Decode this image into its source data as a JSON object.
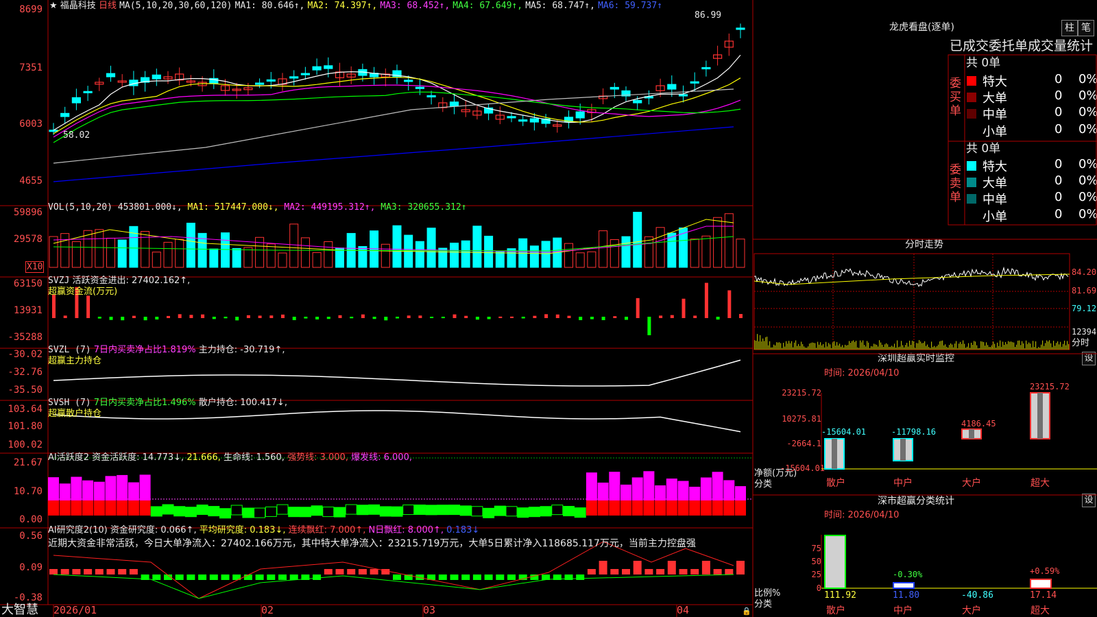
{
  "colors": {
    "up": "#ff3232",
    "down": "#00ffff",
    "bg": "#000000",
    "frame": "#b00000",
    "grid": "#7a0000",
    "ma1": "#ffffff",
    "ma2": "#ffff00",
    "ma3": "#ff00ff",
    "ma4": "#00ff00",
    "ma5": "#c0c0c0",
    "ma6": "#0000ff"
  },
  "header": {
    "star": "★",
    "stock_name": "福晶科技",
    "period": "日线",
    "ma_params": "MA(5,10,20,30,60,120)",
    "ma1": "MA1: 80.646↑,",
    "ma2": "MA2: 74.397↑,",
    "ma3": "MA3: 68.452↑,",
    "ma4": "MA4: 67.649↑,",
    "ma5": "MA5: 68.747↑,",
    "ma6": "MA6: 59.737↑",
    "high_label": "86.99",
    "low_label": "58.02"
  },
  "main_axis": [
    "8699",
    "7351",
    "6003",
    "4655"
  ],
  "vol": {
    "title": "VOL(5,10,20)",
    "value": "453801.000↓,",
    "ma1": "MA1: 517447.000↓,",
    "ma2": "MA2: 449195.312↑,",
    "ma3": "MA3: 320655.312↑",
    "axis": [
      "59896",
      "29578"
    ],
    "unit": "X10"
  },
  "svzj": {
    "title": "SVZJ",
    "label": "活跃资金进出: 27402.162↑,",
    "sub": "超赢资金流(万元)",
    "axis": [
      "63150",
      "13931",
      "-35288"
    ]
  },
  "svzl": {
    "title": "SVZL (7)",
    "label1": "7日内买卖净占比1.819%",
    "label2": "主力持仓: -30.719↑,",
    "sub": "超赢主力持仓",
    "axis": [
      "-30.02",
      "-32.76",
      "-35.50"
    ]
  },
  "svsh": {
    "title": "SVSH (7)",
    "label1": "7日内买卖净占比1.496%",
    "label2": "散户持仓: 100.417↓,",
    "sub": "超赢散户持仓",
    "axis": [
      "103.64",
      "101.80",
      "100.02"
    ]
  },
  "ai1": {
    "title": "AI活跃度2",
    "l1": "资金活跃度: 14.773↓,",
    "l2": "21.666,",
    "l3": "生命线: 1.560,",
    "l4": "强势线: 3.000,",
    "l5": "爆发线: 6.000,",
    "axis": [
      "21.67",
      "10.70",
      "0.00"
    ]
  },
  "ai2": {
    "title": "AI研究度2(10)",
    "l1": "资金研究度: 0.066↑,",
    "l2": "平均研究度: 0.183↓,",
    "l3": "连续飘红: 7.000↑,",
    "l4": "N日飘红: 8.000↑,",
    "l5": "0.183↓",
    "text": "近期大资金非常活跃，今日大单净流入：27402.166万元，其中特大单净流入：23215.719万元，大单5日累计净入118685.117万元，当前主力控盘强",
    "axis": [
      "0.56",
      "0.09",
      "-0.38"
    ]
  },
  "dates": [
    "2026/01",
    "02",
    "03",
    "04"
  ],
  "brand": "大智慧",
  "lhb": {
    "title": "龙虎看盘(逐单)",
    "btn1": "柱",
    "btn2": "笔",
    "tabs": "已成交委托单成交量统计",
    "buy": {
      "label": "委买单",
      "total": "共 0单",
      "rows": [
        {
          "name": "特大",
          "n": "0",
          "p": "0%"
        },
        {
          "name": "大单",
          "n": "0",
          "p": "0%"
        },
        {
          "name": "中单",
          "n": "0",
          "p": "0%"
        },
        {
          "name": "小单",
          "n": "0",
          "p": "0%"
        }
      ]
    },
    "sell": {
      "label": "委卖单",
      "total": "共 0单",
      "rows": [
        {
          "name": "特大",
          "n": "0",
          "p": "0%"
        },
        {
          "name": "大单",
          "n": "0",
          "p": "0%"
        },
        {
          "name": "中单",
          "n": "0",
          "p": "0%"
        },
        {
          "name": "小单",
          "n": "0",
          "p": "0%"
        }
      ]
    }
  },
  "fenshi": {
    "title": "分时走势",
    "axis": [
      "84.20",
      "81.69",
      "79.12",
      "12394"
    ],
    "unit": "分时"
  },
  "sz": {
    "title": "深圳超赢实时监控",
    "btn": "设",
    "time": "时间: 2026/04/10",
    "axis": [
      "23215.72",
      "10275.81",
      "-2664.1",
      "-15604.01"
    ],
    "yname": "净额(万元)",
    "xname": "分类",
    "cats": [
      "散户",
      "中户",
      "大户",
      "超大"
    ],
    "values": [
      "-15604.01",
      "-11798.16",
      "4186.45",
      "23215.72"
    ]
  },
  "ss": {
    "title": "深市超赢分类统计",
    "btn": "设",
    "time": "时间: 2026/04/10",
    "axis": [
      "75",
      "50",
      "25",
      "0"
    ],
    "yname": "比例%",
    "xname": "分类",
    "cats": [
      "散户",
      "中户",
      "大户",
      "超大"
    ],
    "vals": [
      "111.92",
      "11.80",
      "-40.86",
      "17.14"
    ],
    "pcts": [
      "-0.30%",
      "+0.59%"
    ]
  }
}
